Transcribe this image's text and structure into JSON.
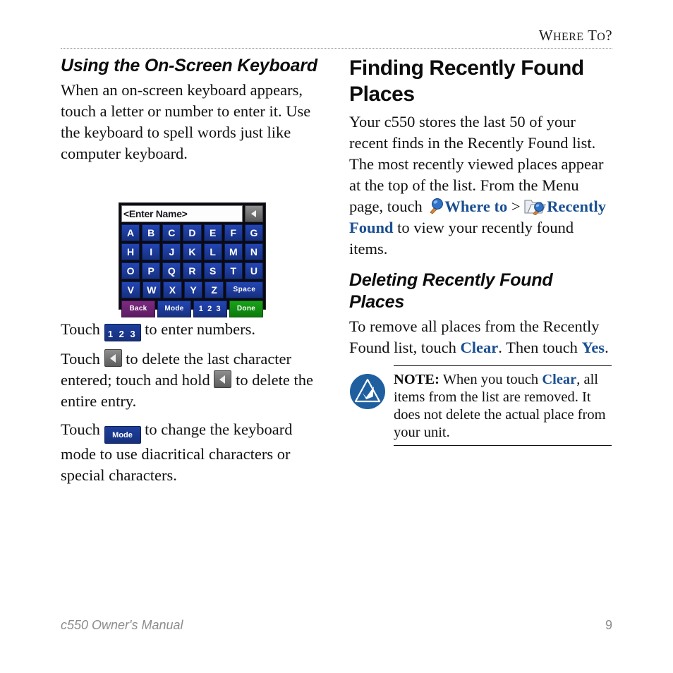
{
  "header": {
    "title_lead": "W",
    "title_rest_1": "HERE",
    "title_lead_2": "T",
    "title_rest_2": "O",
    "title_end": "?",
    "title_full": "Where To?"
  },
  "left_column": {
    "heading": "Using the On-Screen Keyboard",
    "intro_paragraph": "When an on-screen keyboard appears, touch a letter or number to enter it. Use the keyboard to spell words just like computer keyboard.",
    "keyboard_figure": {
      "field_value": "<Enter Name>",
      "backspace_icon": "backspace-triangle-icon",
      "rows": [
        [
          "A",
          "B",
          "C",
          "D",
          "E",
          "F",
          "G"
        ],
        [
          "H",
          "I",
          "J",
          "K",
          "L",
          "M",
          "N"
        ],
        [
          "O",
          "P",
          "Q",
          "R",
          "S",
          "T",
          "U"
        ]
      ],
      "row4": [
        "V",
        "W",
        "X",
        "Y",
        "Z"
      ],
      "space_label": "Space",
      "bottom_row": [
        "Back",
        "Mode",
        "1 2 3",
        "Done"
      ],
      "colors": {
        "key": "#1d3da4",
        "back": "#6d2273",
        "done": "#12900f",
        "background": "#0a0a12"
      }
    },
    "paragraph_numbers_a": "Touch ",
    "button_123_label": "1 2 3",
    "paragraph_numbers_b": " to enter numbers.",
    "paragraph_delete_a": "Touch ",
    "paragraph_delete_b": " to delete the last character entered; touch and hold ",
    "paragraph_delete_c": " to delete the entire entry.",
    "paragraph_mode_a": "Touch ",
    "button_mode_label": "Mode",
    "paragraph_mode_b": " to change the keyboard mode to use diacritical characters or special characters."
  },
  "right_column": {
    "heading": "Finding Recently Found Places",
    "paragraph_a": "Your c550 stores the last 50 of your recent finds in the Recently Found list. The most recently viewed places appear at the top of the list. From the Menu page, touch ",
    "link_where_to": "Where to",
    "separator": " > ",
    "link_recently_found": "Recently Found",
    "paragraph_b": " to view your recently found items.",
    "subheading": "Deleting Recently Found Places",
    "delete_paragraph_a": "To remove all places from the Recently Found list, touch ",
    "link_clear": "Clear",
    "delete_paragraph_b": ". Then touch ",
    "link_yes": "Yes",
    "delete_paragraph_c": ".",
    "link_color": "#1a4f91"
  },
  "note": {
    "badge_icon": "note-triangle-check-icon",
    "badge_color": "#1f5fa0",
    "label": "NOTE:",
    "text_a": " When you touch ",
    "link_clear": "Clear",
    "text_b": ", all items from the list are removed. It does not delete the actual place from your unit."
  },
  "footer": {
    "left": "c550 Owner's Manual",
    "page_number": "9"
  }
}
